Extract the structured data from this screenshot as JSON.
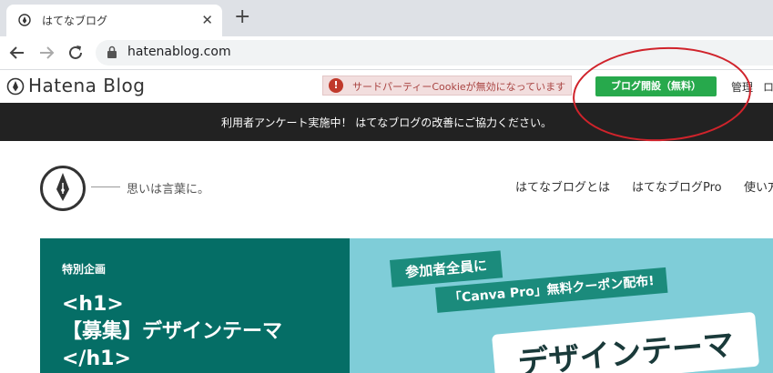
{
  "browser": {
    "tab_title": "はてなブログ",
    "new_tab_symbol": "+",
    "close_symbol": "✕",
    "url": "hatenablog.com"
  },
  "header": {
    "logo_text": "Hatena Blog",
    "cookie_warning": "サードパーティーCookieが無効になっています",
    "cookie_icon_symbol": "!",
    "open_blog_button": "ブログ開設（無料）",
    "admin_link": "管理",
    "extra_link": "ロ"
  },
  "announcement": {
    "text": "利用者アンケート実施中！ はてなブログの改善にご協力ください。"
  },
  "site": {
    "tagline": "思いは言葉に。",
    "nav": [
      "はてなブログとは",
      "はてなブログPro",
      "使い方"
    ]
  },
  "hero": {
    "tag": "特別企画",
    "title": "<h1>\n【募集】デザインテーマ\n</h1>",
    "ribbon1": "参加者全員に",
    "ribbon2": "「Canva Pro」無料クーポン配布!",
    "card_text": "デザインテーマ"
  },
  "colors": {
    "green_button": "#27a94c",
    "hero_dark": "#056e66",
    "hero_light": "#7fcdd8",
    "annotation_red": "#d0232b"
  }
}
